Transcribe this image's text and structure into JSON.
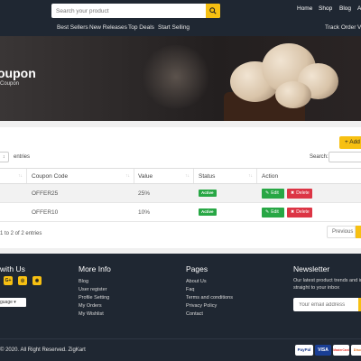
{
  "header": {
    "search_placeholder": "Search your product",
    "nav": [
      "Home",
      "Shop",
      "Blog",
      "A"
    ],
    "subnav": [
      "Best Sellers",
      "New Releases",
      "Top Deals",
      "Start Selling"
    ],
    "track_order": "Track Order",
    "extra": "Va"
  },
  "hero": {
    "title": "oupon",
    "breadcrumb": "Coupon"
  },
  "toolbar": {
    "add_label": "+ Add",
    "entries_value": "",
    "entries_label": "entries",
    "search_label": "Search:"
  },
  "table": {
    "columns": [
      "Coupon Code",
      "Value",
      "Status",
      "Action"
    ],
    "rows": [
      {
        "code": "OFFER25",
        "value": "25%",
        "status": "Active",
        "edit": "Edit",
        "delete": "Delete"
      },
      {
        "code": "OFFER10",
        "value": "10%",
        "status": "Active",
        "edit": "Edit",
        "delete": "Delete"
      }
    ],
    "info": "1 to 2 of 2 entries",
    "previous": "Previous"
  },
  "footer": {
    "connect_title": "with Us",
    "social": [
      "G+",
      "◎",
      "◉"
    ],
    "language": "guage",
    "more_info": {
      "title": "More Info",
      "links": [
        "Blog",
        "User register",
        "Profile Setting",
        "My Orders",
        "My Wishlist"
      ]
    },
    "pages": {
      "title": "Pages",
      "links": [
        "About Us",
        "Faq",
        "Terms and conditions",
        "Privacy Policy",
        "Contact"
      ]
    },
    "newsletter": {
      "title": "Newsletter",
      "text": "Our latest product trends and in straight to your inbox",
      "placeholder": "Your email address"
    },
    "copyright": "© 2020. All Right Reserved. ZigKart",
    "payments": [
      "PayPal",
      "VISA",
      "MasterCard",
      "Disc"
    ]
  },
  "colors": {
    "accent": "#f7c012",
    "dark": "#1f2732",
    "success": "#28a745",
    "danger": "#dc3545"
  }
}
